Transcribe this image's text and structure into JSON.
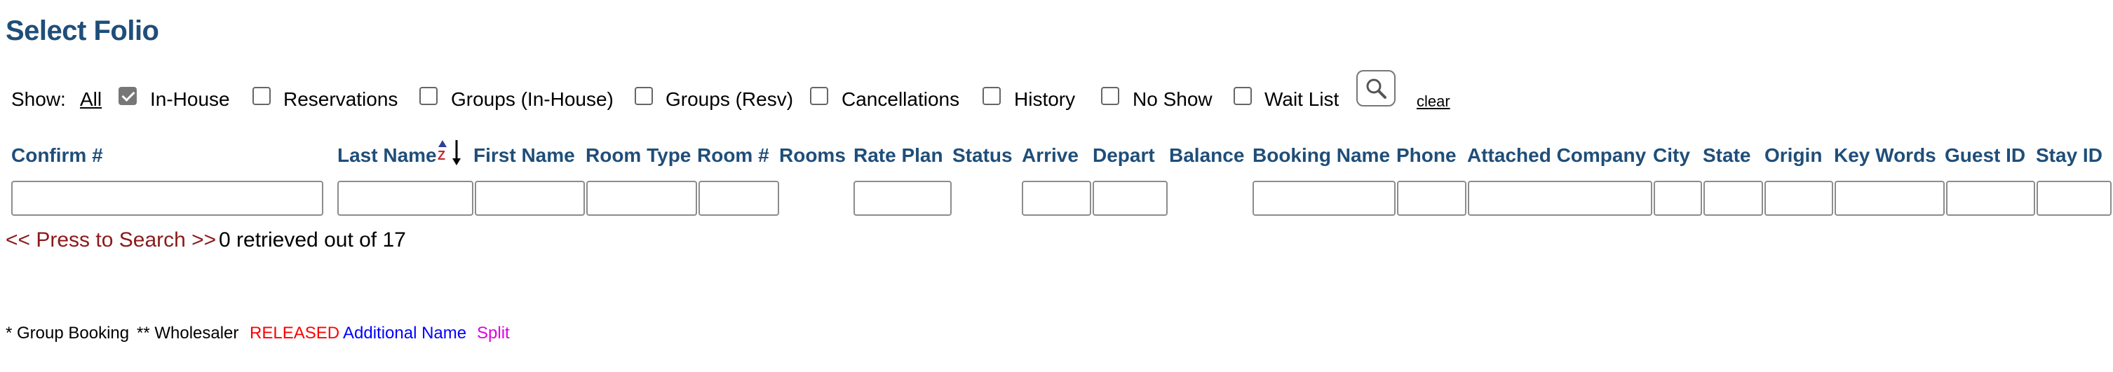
{
  "page_title": "Select Folio",
  "show": {
    "label": "Show:",
    "all_link": "All",
    "filters": [
      {
        "label": "In-House",
        "checked": true
      },
      {
        "label": "Reservations",
        "checked": false
      },
      {
        "label": "Groups (In-House)",
        "checked": false
      },
      {
        "label": "Groups (Resv)",
        "checked": false
      },
      {
        "label": "Cancellations",
        "checked": false
      },
      {
        "label": "History",
        "checked": false
      },
      {
        "label": "No Show",
        "checked": false
      },
      {
        "label": "Wait List",
        "checked": false
      }
    ],
    "search_icon": "search-icon",
    "clear_link": "clear"
  },
  "columns": [
    "Confirm #",
    "Last Name",
    "First Name",
    "Room Type",
    "Room #",
    "Rooms",
    "Rate Plan",
    "Status",
    "Arrive",
    "Depart",
    "Balance",
    "Booking Name",
    "Phone",
    "Attached Company",
    "City",
    "State",
    "Origin",
    "Key Words",
    "Guest ID",
    "Stay ID"
  ],
  "sort_icon": "sort-az-icon",
  "search_prompt": "<< Press to Search >>",
  "result_status": "0 retrieved out of 17",
  "legend": {
    "group_booking": "* Group Booking",
    "wholesaler": "** Wholesaler",
    "released": "RELEASED",
    "additional_name": "Additional Name",
    "split": "Split"
  },
  "colors": {
    "heading": "#1f4e79",
    "search_prompt": "#8b1a1a",
    "released": "#ff0000",
    "additional_name": "#0000ff",
    "split": "#e000e0"
  }
}
